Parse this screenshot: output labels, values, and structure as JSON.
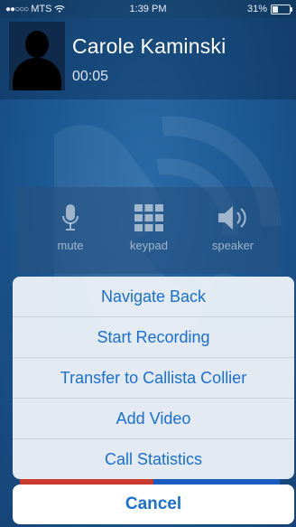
{
  "status_bar": {
    "carrier": "MTS",
    "signal_dots": "●●○○○",
    "wifi_icon": "wifi-icon",
    "time": "1:39 PM",
    "battery": "31%",
    "battery_level": 0.31
  },
  "call": {
    "caller_name": "Carole Kaminski",
    "duration": "00:05"
  },
  "controls": [
    {
      "label": "mute",
      "icon": "microphone-icon"
    },
    {
      "label": "keypad",
      "icon": "keypad-icon"
    },
    {
      "label": "speaker",
      "icon": "speaker-icon"
    }
  ],
  "action_sheet": {
    "items": [
      "Navigate Back",
      "Start Recording",
      "Transfer to Callista Collier",
      "Add Video",
      "Call Statistics"
    ],
    "cancel": "Cancel"
  },
  "colors": {
    "background": "#1d5a95",
    "action_text": "#1a6fd1",
    "end_call": "#c83a2e"
  }
}
